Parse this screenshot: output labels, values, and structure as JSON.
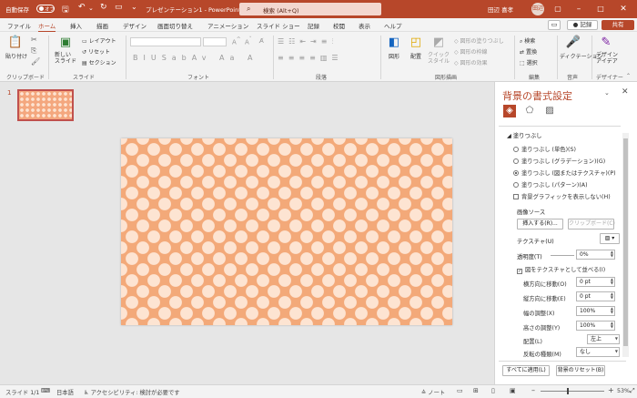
{
  "titlebar": {
    "autosave_label": "自動保存",
    "toggle_state": "オフ",
    "doc_title": "プレゼンテーション1 - PowerPoint",
    "search_placeholder": "検索 (Alt+Q)",
    "user_name": "田辺 喜孝",
    "avatar_initials": "田辺"
  },
  "menubar": {
    "tabs": [
      "ファイル",
      "ホーム",
      "挿入",
      "描画",
      "デザイン",
      "画面切り替え",
      "アニメーション",
      "スライド ショー",
      "記録",
      "校閲",
      "表示",
      "ヘルプ"
    ],
    "active_tab": "ホーム",
    "record_label": "● 記録",
    "share_label": "共有"
  },
  "ribbon": {
    "clipboard": {
      "paste": "貼り付け",
      "group": "クリップボード"
    },
    "slides": {
      "new_slide": "新しい\nスライド",
      "layout": "レイアウト",
      "reset": "リセット",
      "section": "セクション",
      "group": "スライド"
    },
    "font": {
      "group": "フォント"
    },
    "paragraph": {
      "group": "段落"
    },
    "drawing": {
      "shapes": "図形",
      "arrange": "配置",
      "quick_styles": "クイック\nスタイル",
      "fill": "図形の塗りつぶし",
      "outline": "図形の枠線",
      "effects": "図形の効果",
      "group": "図形描画"
    },
    "editing": {
      "find": "検索",
      "replace": "置換",
      "select": "選択",
      "group": "編集"
    },
    "voice": {
      "dictate": "ディクテーション",
      "group": "音声"
    },
    "designer": {
      "label": "デザイン\nアイデア",
      "group": "デザイナー"
    }
  },
  "slides_panel": {
    "slide_number": "1"
  },
  "format_pane": {
    "title": "背景の書式設定",
    "section": "塗りつぶし",
    "options": [
      "塗りつぶし (単色)(S)",
      "塗りつぶし (グラデーション)(G)",
      "塗りつぶし (図またはテクスチャ)(P)",
      "塗りつぶし (パターン)(A)"
    ],
    "selected_option": 2,
    "hide_graphics": "背景グラフィックを表示しない(H)",
    "picture_source": "画像ソース",
    "insert_btn": "挿入する(R)...",
    "clipboard_btn": "クリップボード(C)",
    "texture_label": "テクスチャ(U)",
    "transparency_label": "透明度(T)",
    "transparency_value": "0%",
    "tile_label": "図をテクスチャとして並べる(I)",
    "offset_x_label": "横方向に移動(O)",
    "offset_x": "0 pt",
    "offset_y_label": "縦方向に移動(E)",
    "offset_y": "0 pt",
    "scale_x_label": "幅の調整(X)",
    "scale_x": "100%",
    "scale_y_label": "高さの調整(Y)",
    "scale_y": "100%",
    "alignment_label": "配置(L)",
    "alignment": "左上",
    "mirror_label": "反転の種類(M)",
    "mirror": "なし",
    "apply_all": "すべてに適用(L)",
    "reset_bg": "背景のリセット(B)"
  },
  "statusbar": {
    "slide_info": "スライド 1/1",
    "language": "日本語",
    "accessibility": "アクセシビリティ: 検討が必要です",
    "notes": "ノート",
    "zoom": "53%"
  },
  "colors": {
    "accent": "#b7472a",
    "slide_bg": "#f3a979",
    "dot": "#fde4d2"
  }
}
